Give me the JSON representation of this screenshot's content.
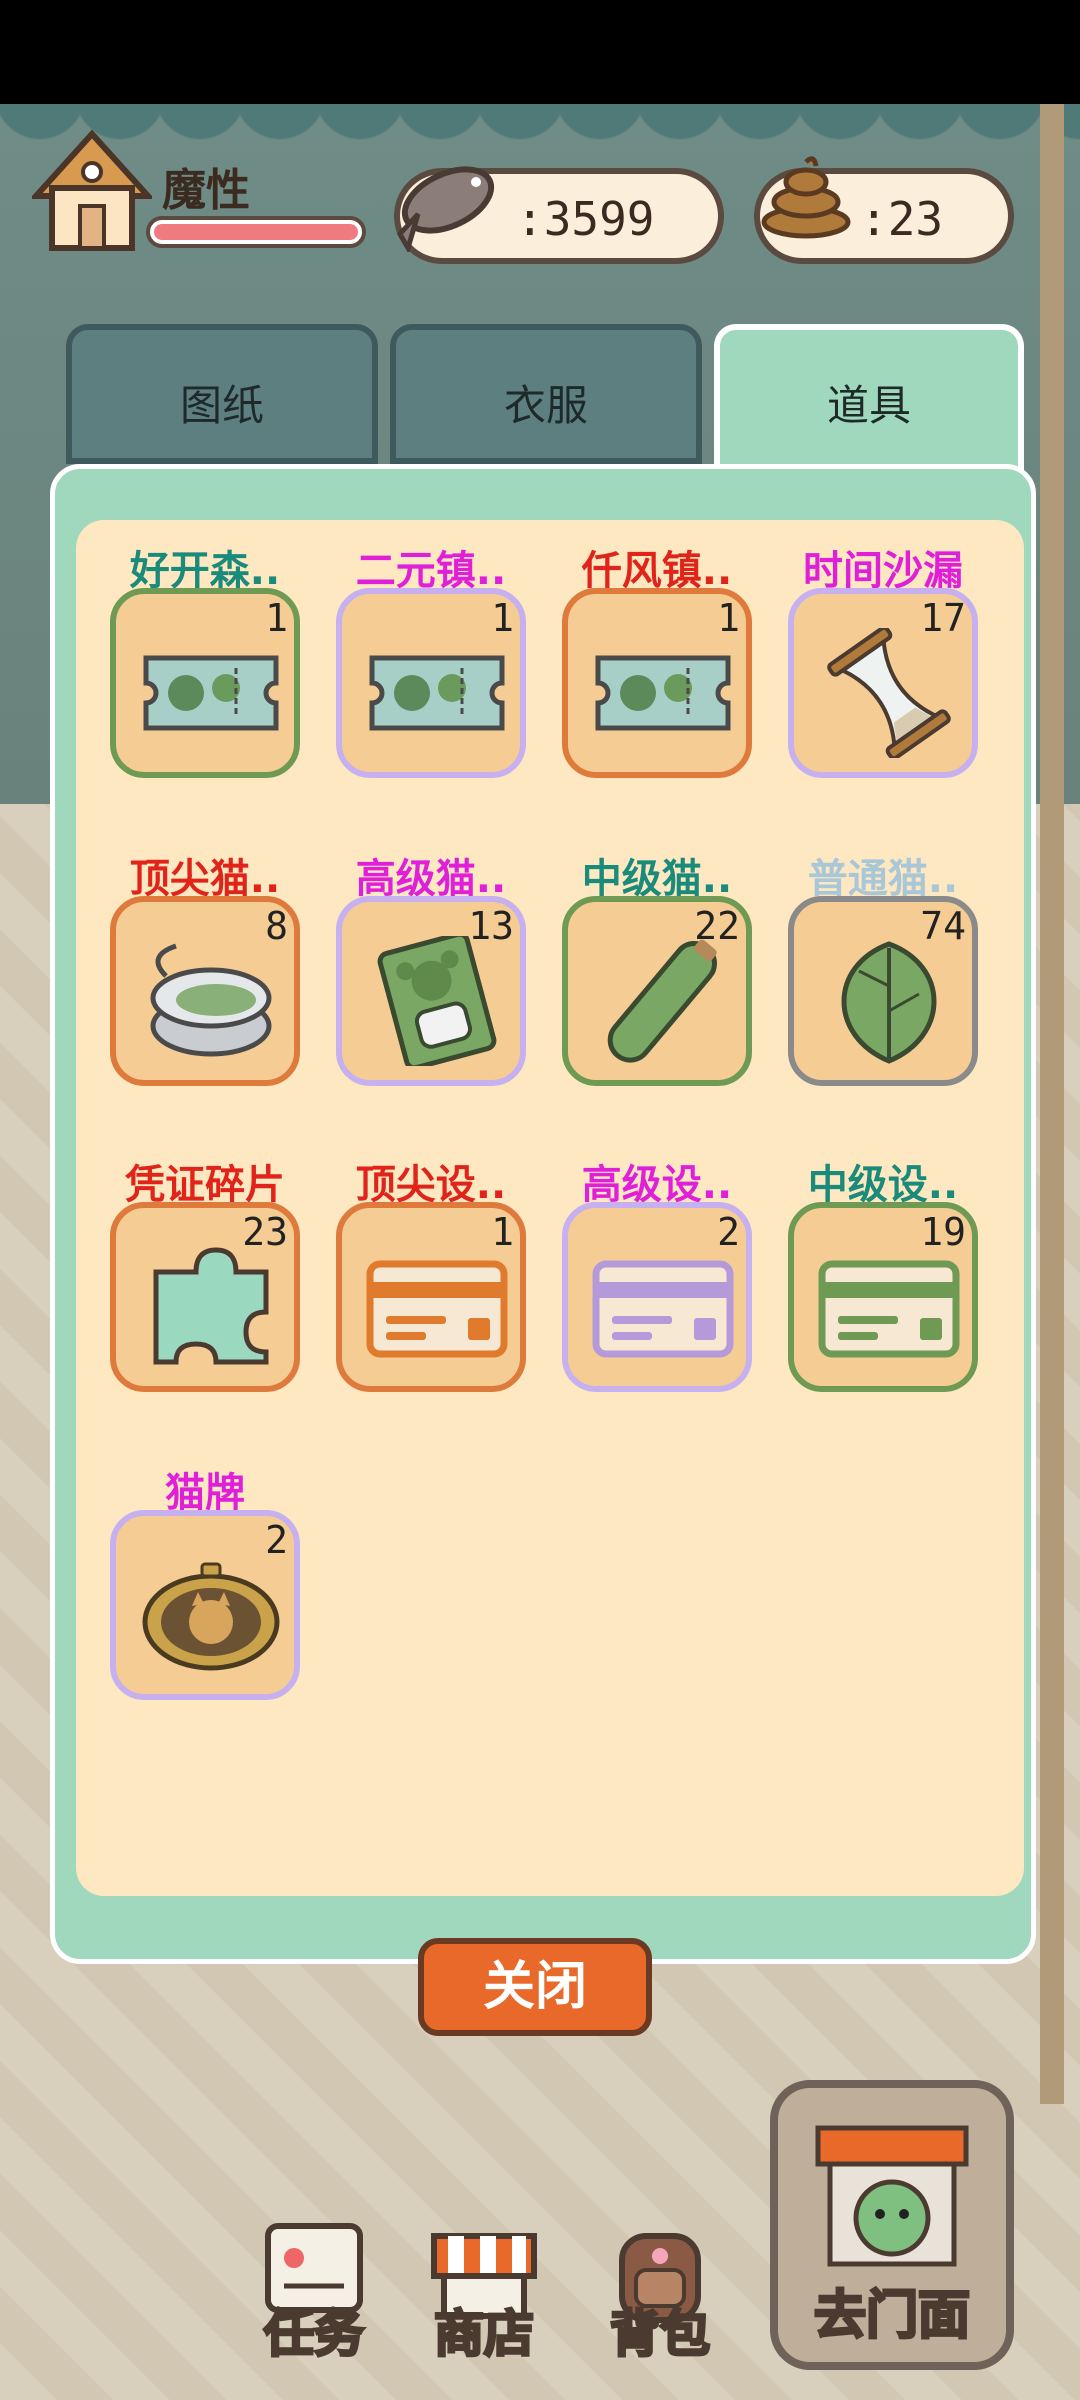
{
  "player": {
    "name": "魔性",
    "hp_fraction": 1.0
  },
  "currency": {
    "fish": ":3599",
    "poop": ":23"
  },
  "tabs": [
    {
      "label": "图纸",
      "active": false
    },
    {
      "label": "衣服",
      "active": false
    },
    {
      "label": "道具",
      "active": true
    }
  ],
  "items": [
    {
      "label": "好开森..",
      "qty": "1",
      "rarity": "green",
      "label_color": "#1a8a7a",
      "icon": "ticket-map-icon"
    },
    {
      "label": "二元镇..",
      "qty": "1",
      "rarity": "purple",
      "label_color": "#e01fd8",
      "icon": "ticket-map-icon"
    },
    {
      "label": "仟风镇..",
      "qty": "1",
      "rarity": "orange",
      "label_color": "#e0241a",
      "icon": "ticket-map-icon"
    },
    {
      "label": "时间沙漏",
      "qty": "17",
      "rarity": "purple",
      "label_color": "#e01fd8",
      "icon": "hourglass-icon"
    },
    {
      "label": "顶尖猫..",
      "qty": "8",
      "rarity": "orange",
      "label_color": "#e0241a",
      "icon": "cat-can-icon"
    },
    {
      "label": "高级猫..",
      "qty": "13",
      "rarity": "purple",
      "label_color": "#e01fd8",
      "icon": "treat-bag-icon"
    },
    {
      "label": "中级猫..",
      "qty": "22",
      "rarity": "green",
      "label_color": "#1a8a7a",
      "icon": "cucumber-icon"
    },
    {
      "label": "普通猫..",
      "qty": "74",
      "rarity": "gray",
      "label_color": "#a9c7d6",
      "icon": "leaf-icon"
    },
    {
      "label": "凭证碎片",
      "qty": "23",
      "rarity": "orange",
      "label_color": "#e0241a",
      "icon": "puzzle-piece-icon"
    },
    {
      "label": "顶尖设..",
      "qty": "1",
      "rarity": "orange",
      "label_color": "#e0241a",
      "icon": "card-icon",
      "card_color": "#e07a2c"
    },
    {
      "label": "高级设..",
      "qty": "2",
      "rarity": "purple",
      "label_color": "#e01fd8",
      "icon": "card-icon",
      "card_color": "#b49ad8"
    },
    {
      "label": "中级设..",
      "qty": "19",
      "rarity": "green",
      "label_color": "#1a8a7a",
      "icon": "card-icon",
      "card_color": "#6f9a54"
    },
    {
      "label": "猫牌",
      "qty": "2",
      "rarity": "purple",
      "label_color": "#e01fd8",
      "icon": "cat-badge-icon"
    }
  ],
  "close_button": "关闭",
  "nav": {
    "tasks": "任务",
    "shop": "商店",
    "backpack": "背包",
    "store": "去门面"
  }
}
